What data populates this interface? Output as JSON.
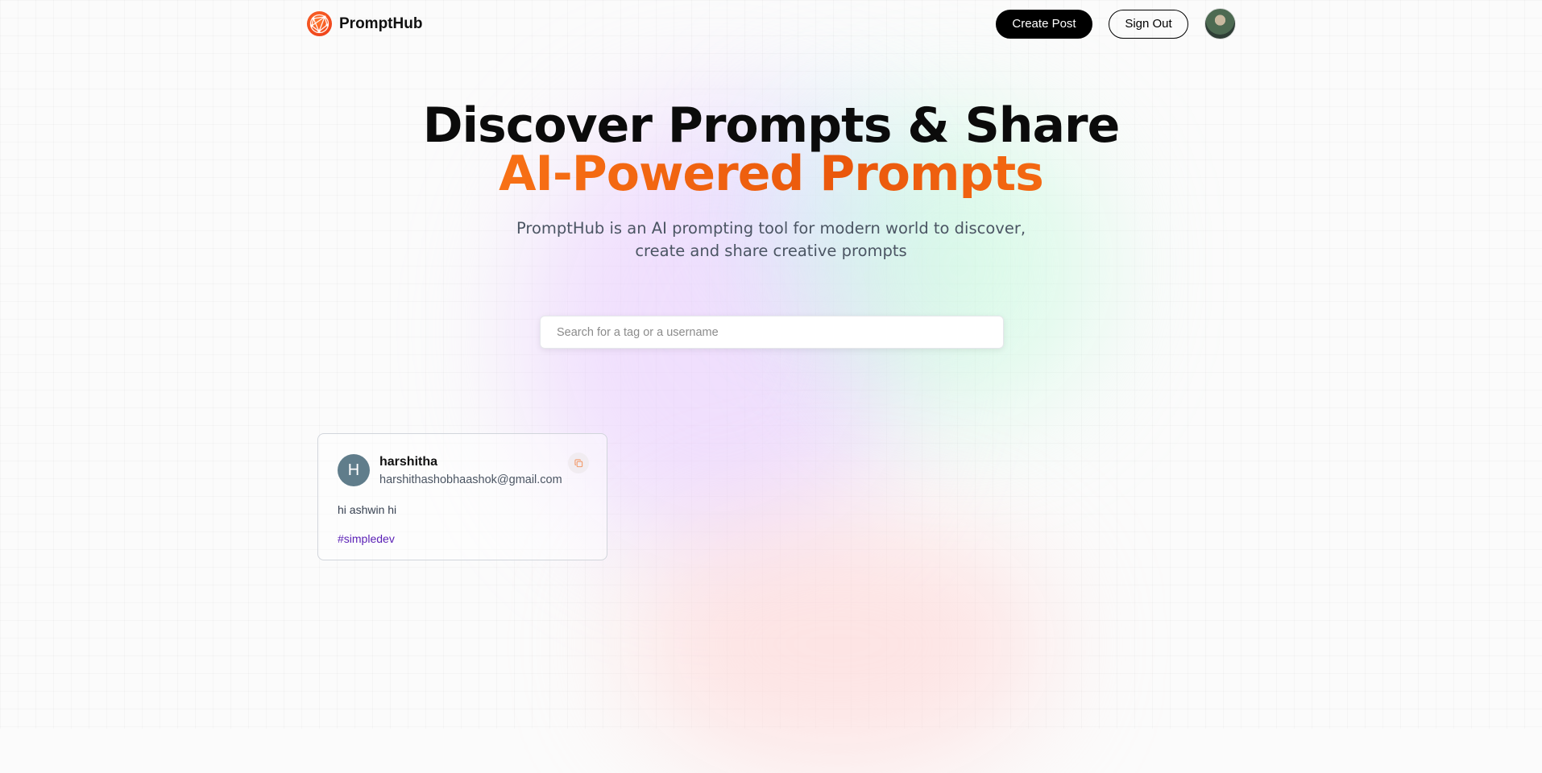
{
  "nav": {
    "brand": "PromptHub",
    "create_post": "Create Post",
    "sign_out": "Sign Out"
  },
  "hero": {
    "title_line1": "Discover Prompts & Share",
    "title_line2": "AI-Powered Prompts",
    "description": "PromptHub is an AI prompting tool for modern world to discover, create and share creative prompts"
  },
  "search": {
    "placeholder": "Search for a tag or a username",
    "value": ""
  },
  "posts": [
    {
      "avatar_initial": "H",
      "username": "harshitha",
      "email": "harshithashobhaashok@gmail.com",
      "text": "hi ashwin hi",
      "tag": "#simpledev"
    }
  ],
  "colors": {
    "accent_start": "#f59e0b",
    "accent_mid": "#ea580c",
    "logo": "#f0451c",
    "tag": "#5b21b6",
    "avatar_bg": "#607d8b"
  },
  "icons": {
    "logo": "network-globe-icon",
    "copy": "copy-icon"
  }
}
